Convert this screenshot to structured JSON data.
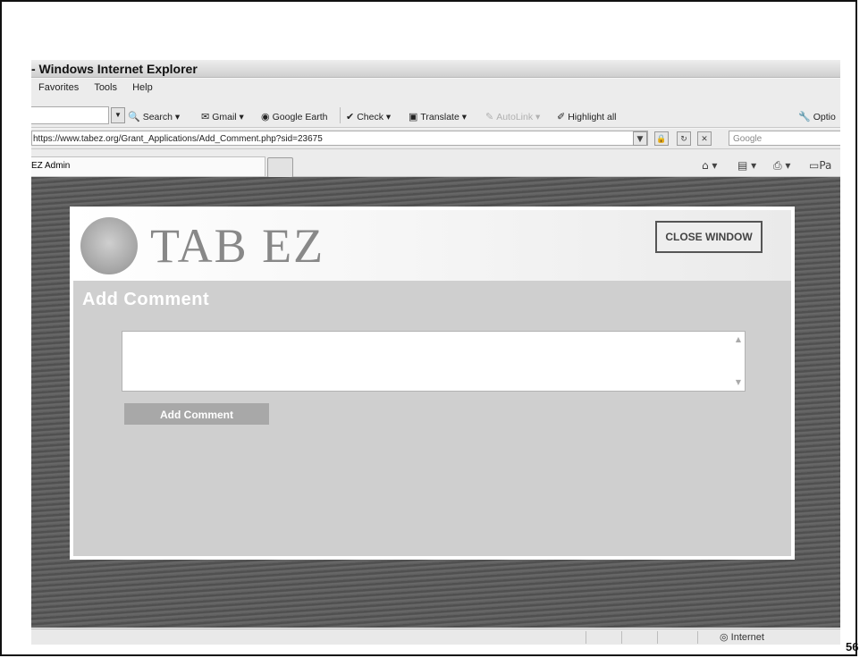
{
  "window": {
    "title": "- Windows Internet Explorer"
  },
  "menu": {
    "items": [
      "Favorites",
      "Tools",
      "Help"
    ]
  },
  "toolbar": {
    "search_label": "Search",
    "gmail_label": "Gmail",
    "google_earth_label": "Google Earth",
    "check_label": "Check",
    "translate_label": "Translate",
    "autolink_label": "AutoLink",
    "highlight_label": "Highlight all",
    "options_label": "Optio"
  },
  "address_bar": {
    "url": "https://www.tabez.org/Grant_Applications/Add_Comment.php?sid=23675",
    "search_placeholder": "Google"
  },
  "tab": {
    "title": "EZ Admin",
    "page_label": "Pa"
  },
  "popup": {
    "logo_text": "TAB EZ",
    "close_label": "CLOSE WINDOW",
    "page_title": "Add Comment",
    "comment_value": "",
    "submit_label": "Add Comment"
  },
  "status_bar": {
    "zone": "Internet"
  },
  "slide": {
    "page_number": "56"
  }
}
